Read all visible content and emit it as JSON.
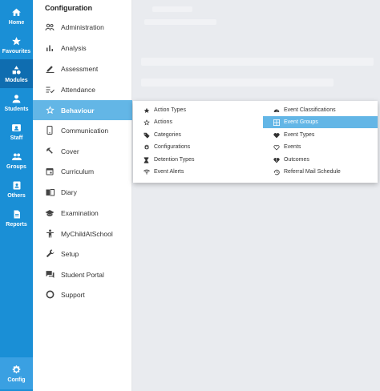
{
  "rail": {
    "items": [
      {
        "label": "Home",
        "icon": "home-icon"
      },
      {
        "label": "Favourites",
        "icon": "star-icon"
      },
      {
        "label": "Modules",
        "icon": "modules-icon"
      },
      {
        "label": "Students",
        "icon": "person-icon"
      },
      {
        "label": "Staff",
        "icon": "staff-icon"
      },
      {
        "label": "Groups",
        "icon": "groups-icon"
      },
      {
        "label": "Others",
        "icon": "contacts-icon"
      },
      {
        "label": "Reports",
        "icon": "document-icon"
      },
      {
        "label": "Config",
        "icon": "gear-icon"
      }
    ]
  },
  "menu": {
    "title": "Configuration",
    "items": [
      {
        "label": "Administration",
        "icon": "people-icon"
      },
      {
        "label": "Analysis",
        "icon": "bar-chart-icon"
      },
      {
        "label": "Assessment",
        "icon": "pencil-icon"
      },
      {
        "label": "Attendance",
        "icon": "checklist-icon"
      },
      {
        "label": "Behaviour",
        "icon": "star-outline-icon"
      },
      {
        "label": "Communication",
        "icon": "phone-icon"
      },
      {
        "label": "Cover",
        "icon": "cover-icon"
      },
      {
        "label": "Curriculum",
        "icon": "calendar-icon"
      },
      {
        "label": "Diary",
        "icon": "book-icon"
      },
      {
        "label": "Examination",
        "icon": "graduation-cap-icon"
      },
      {
        "label": "MyChildAtSchool",
        "icon": "child-icon"
      },
      {
        "label": "Setup",
        "icon": "wrench-icon"
      },
      {
        "label": "Student Portal",
        "icon": "chat-icon"
      },
      {
        "label": "Support",
        "icon": "lifebuoy-icon"
      }
    ]
  },
  "submenu": {
    "left": [
      {
        "label": "Action Types",
        "icon": "star-icon"
      },
      {
        "label": "Actions",
        "icon": "star-outline-icon"
      },
      {
        "label": "Categories",
        "icon": "tag-icon"
      },
      {
        "label": "Configurations",
        "icon": "gear-icon"
      },
      {
        "label": "Detention Types",
        "icon": "hourglass-icon"
      },
      {
        "label": "Event Alerts",
        "icon": "wifi-icon"
      }
    ],
    "right": [
      {
        "label": "Event Classifications",
        "icon": "speedometer-icon"
      },
      {
        "label": "Event Groups",
        "icon": "grid-icon"
      },
      {
        "label": "Event Types",
        "icon": "heart-icon"
      },
      {
        "label": "Events",
        "icon": "heart-outline-icon"
      },
      {
        "label": "Outcomes",
        "icon": "heart-broken-icon"
      },
      {
        "label": "Referral Mail Schedule",
        "icon": "history-icon"
      }
    ]
  },
  "colors": {
    "rail": "#1a8fd6",
    "rail_active": "#0f6db0",
    "menu_active": "#63b6e6"
  }
}
